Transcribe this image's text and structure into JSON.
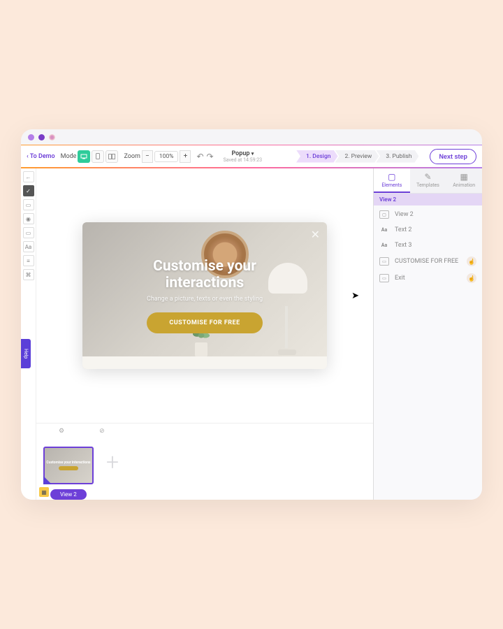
{
  "toolbar": {
    "back_label": "To Demo",
    "mode_label": "Mode",
    "zoom_label": "Zoom",
    "zoom_value": "100%",
    "project_name": "Popup",
    "saved_at": "Saved at 14:59:23",
    "steps": [
      "1. Design",
      "2. Preview",
      "3. Publish"
    ],
    "next_step": "Next step"
  },
  "help_label": "Help",
  "popup": {
    "title_line1": "Customise your",
    "title_line2": "interactions",
    "subtitle": "Change a picture, texts or even the styling",
    "cta": "CUSTOMISE FOR FREE"
  },
  "views": {
    "thumb_label": "View 2",
    "thumb_inner": "Customise your interactions"
  },
  "panel": {
    "tabs": [
      "Elements",
      "Templates",
      "Animation"
    ],
    "section": "View 2",
    "elements": [
      {
        "icon": "view",
        "label": "View 2",
        "action": false
      },
      {
        "icon": "text",
        "label": "Text 2",
        "action": false
      },
      {
        "icon": "text",
        "label": "Text 3",
        "action": false
      },
      {
        "icon": "button",
        "label": "CUSTOMISE FOR FREE",
        "action": true
      },
      {
        "icon": "exit",
        "label": "Exit",
        "action": true
      }
    ]
  }
}
